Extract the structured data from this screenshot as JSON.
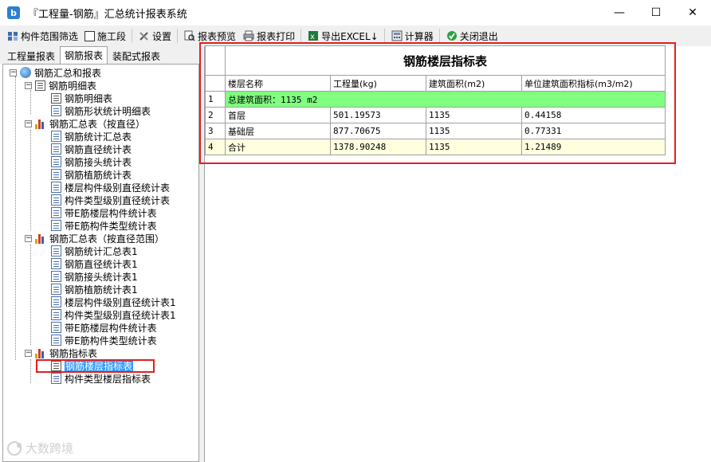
{
  "window": {
    "title": "『工程量-钢筋』汇总统计报表系统",
    "app_icon": "b",
    "min": "—",
    "max": "☐",
    "close": "✕"
  },
  "toolbar": {
    "filter_label": "构件范围筛选",
    "construction_label": "施工段",
    "settings_label": "设置",
    "preview_label": "报表预览",
    "print_label": "报表打印",
    "export_label": "导出EXCEL↓",
    "calculator_label": "计算器",
    "close_label": "关闭退出"
  },
  "tabs": [
    {
      "label": "工程量报表"
    },
    {
      "label": "钢筋报表"
    },
    {
      "label": "装配式报表"
    }
  ],
  "tree": {
    "root": "钢筋汇总和报表",
    "group1": "钢筋明细表",
    "g1_items": [
      "钢筋明细表",
      "钢筋形状统计明细表"
    ],
    "group2": "钢筋汇总表（按直径）",
    "g2_items": [
      "钢筋统计汇总表",
      "钢筋直径统计表",
      "钢筋接头统计表",
      "钢筋植筋统计表",
      "楼层构件级别直径统计表",
      "构件类型级别直径统计表",
      "带E筋楼层构件统计表",
      "带E筋构件类型统计表"
    ],
    "group3": "钢筋汇总表（按直径范围）",
    "g3_items": [
      "钢筋统计汇总表1",
      "钢筋直径统计表1",
      "钢筋接头统计表1",
      "钢筋植筋统计表1",
      "楼层构件级别直径统计表1",
      "构件类型级别直径统计表1",
      "带E筋楼层构件统计表",
      "带E筋构件类型统计表"
    ],
    "group4": "钢筋指标表",
    "g4_items": [
      "钢筋楼层指标表",
      "构件类型楼层指标表"
    ]
  },
  "report": {
    "title": "钢筋楼层指标表",
    "headers": [
      "楼层名称",
      "工程量(kg)",
      "建筑面积(m2)",
      "单位建筑面积指标(m3/m2)"
    ],
    "total_row": {
      "idx": "1",
      "text": "总建筑面积：1135 m2"
    },
    "rows": [
      {
        "idx": "2",
        "name": "首层",
        "qty": "501.19573",
        "area": "1135",
        "index": "0.44158"
      },
      {
        "idx": "3",
        "name": "基础层",
        "qty": "877.70675",
        "area": "1135",
        "index": "0.77331"
      },
      {
        "idx": "4",
        "name": "合计",
        "qty": "1378.90248",
        "area": "1135",
        "index": "1.21489"
      }
    ]
  },
  "watermark": "大数跨境",
  "colors": {
    "total_row_bg": "#80ff80",
    "sum_row_bg": "#ffffe0",
    "highlight_border": "#e02020",
    "selection": "#3399ff"
  }
}
